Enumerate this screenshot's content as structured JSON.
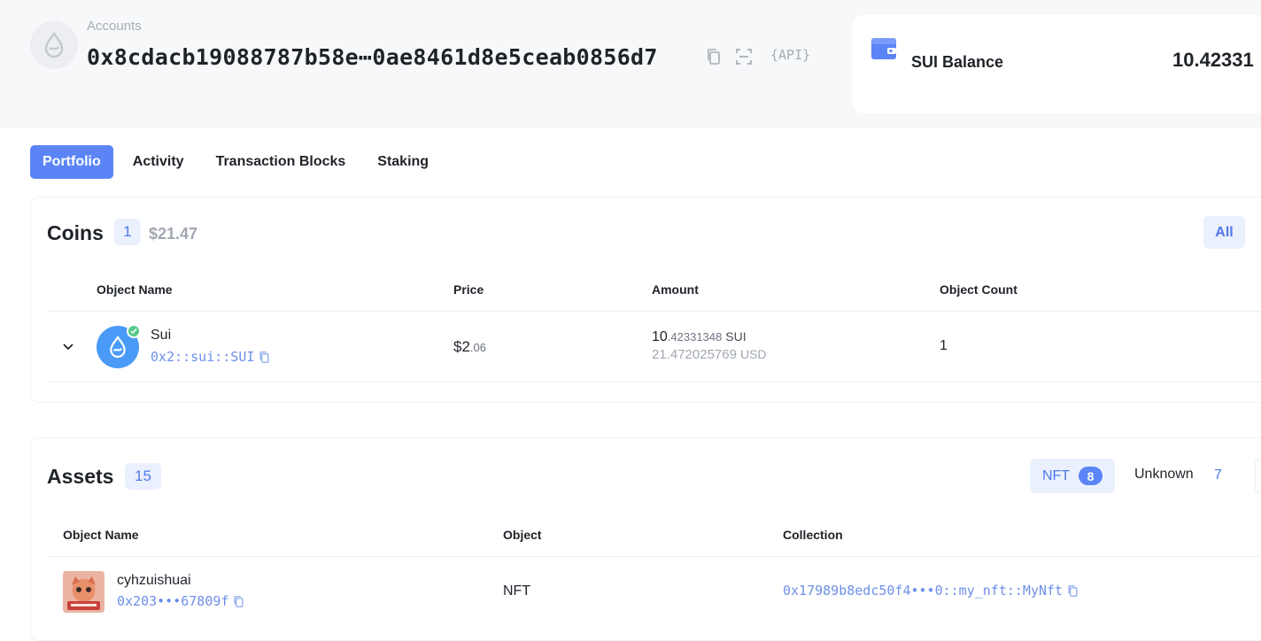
{
  "header": {
    "accounts_label": "Accounts",
    "address": "0x8cdacb19088787b58e⋯0ae8461d8e5ceab0856d7",
    "api_label": "{API}",
    "balance_label": "SUI Balance",
    "balance_value": "10.42331"
  },
  "tabs": [
    {
      "label": "Portfolio",
      "active": true
    },
    {
      "label": "Activity",
      "active": false
    },
    {
      "label": "Transaction Blocks",
      "active": false
    },
    {
      "label": "Staking",
      "active": false
    }
  ],
  "coins": {
    "title": "Coins",
    "count": "1",
    "usd_total": "$21.47",
    "filter_label": "All",
    "columns": [
      "Object Name",
      "Price",
      "Amount",
      "Object Count"
    ],
    "rows": [
      {
        "name": "Sui",
        "type": "0x2::sui::SUI",
        "price_main": "$2",
        "price_decimals": ".06",
        "amount_main": "10",
        "amount_decimals": ".42331348",
        "amount_unit": "SUI",
        "usd_value": "21.472025769",
        "usd_unit": "USD",
        "object_count": "1"
      }
    ]
  },
  "assets": {
    "title": "Assets",
    "count": "15",
    "nft_label": "NFT",
    "nft_count": "8",
    "unknown_label": "Unknown",
    "unknown_count": "7",
    "columns": [
      "Object Name",
      "Object",
      "Collection"
    ],
    "rows": [
      {
        "name": "cyhzuishuai",
        "id": "0x203•••67809f",
        "object": "NFT",
        "collection": "0x17989b8edc50f4•••0::my_nft::MyNft"
      }
    ]
  },
  "colors": {
    "accent": "#5b85f7",
    "link": "#6e8fe9",
    "badge_bg": "#eaf0fe",
    "header_bg": "#f7f8fa",
    "verified": "#57c98a",
    "sui_blue": "#4a9bf7"
  },
  "icons": [
    "sui-logo-icon",
    "copy-icon",
    "qr-scan-icon",
    "wallet-icon",
    "chevron-down-icon",
    "verified-check-icon"
  ]
}
